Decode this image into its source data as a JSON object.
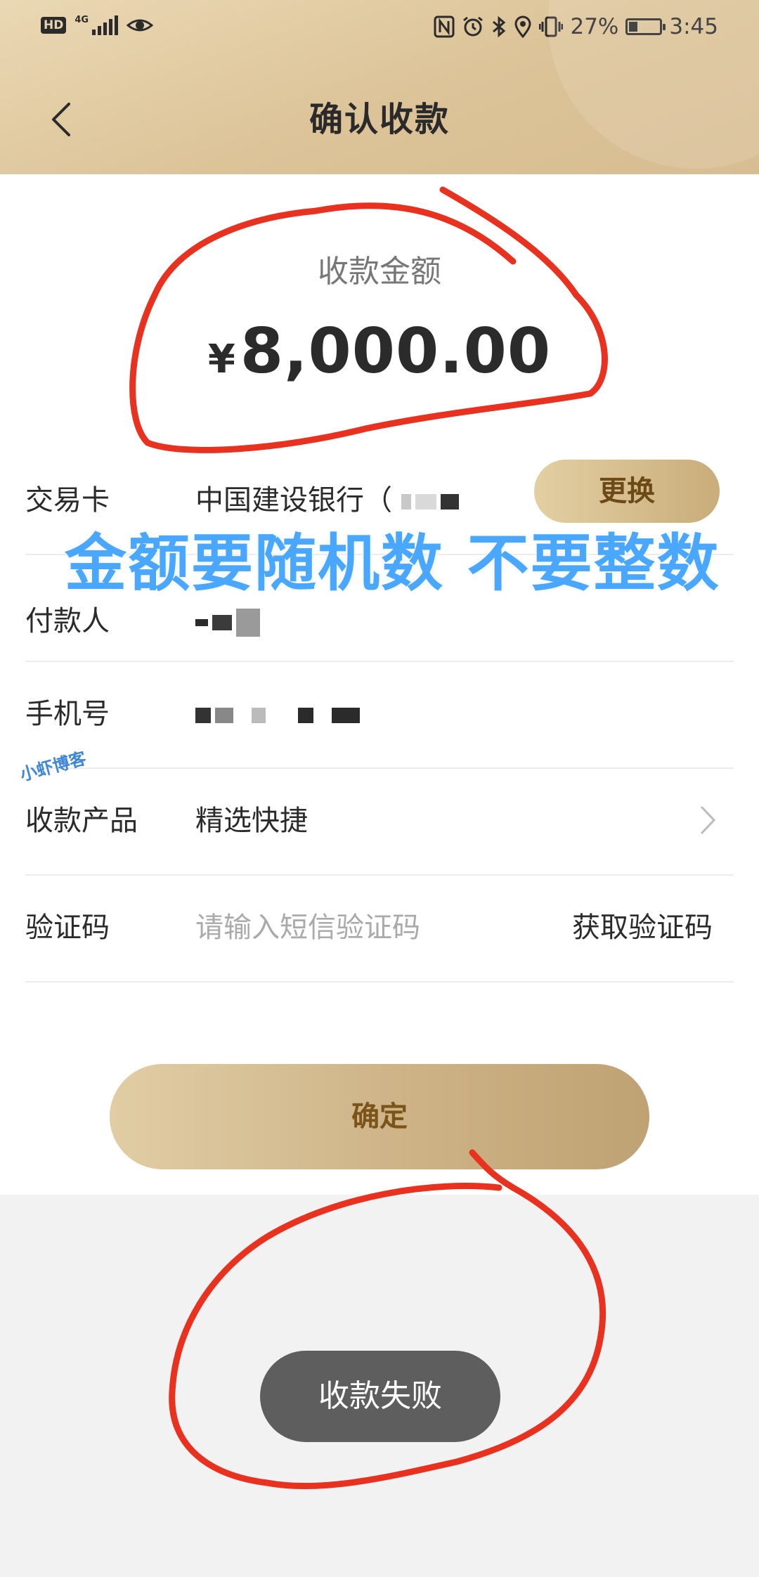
{
  "status_bar": {
    "hd_label": "HD",
    "network_label": "4G",
    "battery_percent": "27%",
    "time": "3:45",
    "icons": [
      "nfc-icon",
      "alarm-icon",
      "bluetooth-icon",
      "location-icon",
      "vibrate-icon",
      "battery-icon"
    ]
  },
  "header": {
    "title": "确认收款"
  },
  "amount": {
    "label": "收款金额",
    "currency": "¥",
    "value": "8,000.00"
  },
  "rows": {
    "card": {
      "label": "交易卡",
      "value": "中国建设银行（",
      "action": "更换"
    },
    "payer": {
      "label": "付款人"
    },
    "phone": {
      "label": "手机号"
    },
    "product": {
      "label": "收款产品",
      "value": "精选快捷"
    },
    "code": {
      "label": "验证码",
      "placeholder": "请输入短信验证码",
      "action": "获取验证码"
    }
  },
  "confirm_label": "确定",
  "toast": "收款失败",
  "annotation": "金额要随机数 不要整数",
  "watermark": "小虾博客",
  "colors": {
    "header_gold": "#dcc398",
    "button_gold": "#cdb386",
    "button_text": "#7a5418",
    "annotation_blue": "#4aa7ff",
    "scribble_red": "#e8321f",
    "toast_bg": "#5e5e5e"
  }
}
